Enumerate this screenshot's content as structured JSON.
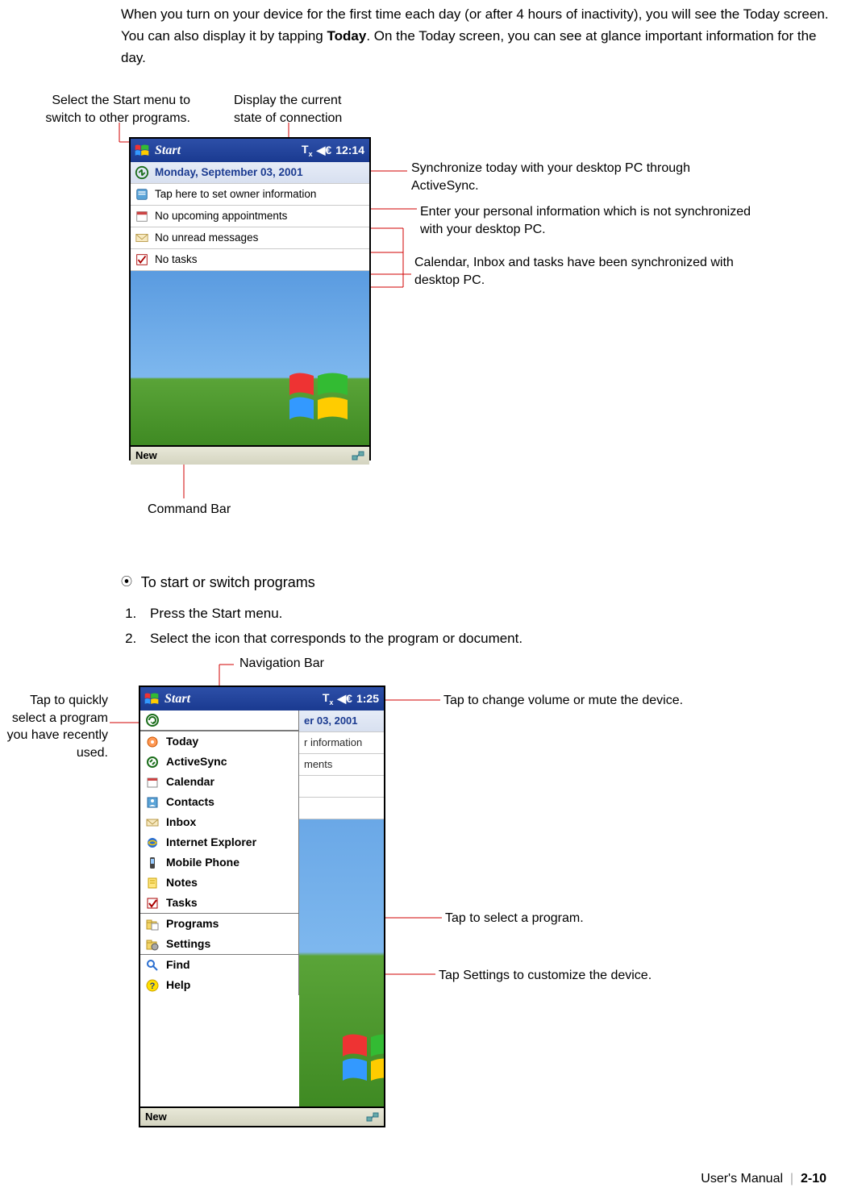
{
  "intro": {
    "text_pre": "When you turn on your device for the first time each day (or after 4 hours of inactivity), you will see the Today screen. You can also display it by tapping ",
    "today_bold": "Today",
    "text_post": ". On the Today screen, you can see at glance important information for the day."
  },
  "annotations1": {
    "start_menu": "Select the Start menu to switch to other programs.",
    "connection": "Display the current state of connection",
    "sync_today": "Synchronize today with your desktop PC through ActiveSync.",
    "owner_info": "Enter your personal information which is not synchronized with your desktop PC.",
    "cal_inbox_tasks": "Calendar, Inbox and tasks have been synchronized with desktop PC.",
    "command_bar": "Command Bar"
  },
  "device1": {
    "start_label": "Start",
    "time": "12:14",
    "date": "Monday, September 03, 2001",
    "owner": "Tap here to set owner information",
    "appointments": "No upcoming appointments",
    "messages": "No unread messages",
    "tasks": "No tasks",
    "cmd_new": "New"
  },
  "section_start": {
    "heading": "To start or switch programs",
    "step1": "Press the Start menu.",
    "step2": "Select the icon that corresponds to the program or document."
  },
  "annotations2": {
    "nav_bar": "Navigation Bar",
    "recent": "Tap to quickly select a program you have recently used.",
    "volume": "Tap to change volume or mute the device.",
    "select_program": "Tap to select a program.",
    "settings": "Tap Settings to customize the device."
  },
  "device2": {
    "start_label": "Start",
    "time": "1:25",
    "menu": {
      "today": "Today",
      "activesync": "ActiveSync",
      "calendar": "Calendar",
      "contacts": "Contacts",
      "inbox": "Inbox",
      "ie": "Internet Explorer",
      "mobile_phone": "Mobile Phone",
      "notes": "Notes",
      "tasks": "Tasks",
      "programs": "Programs",
      "settings": "Settings",
      "find": "Find",
      "help": "Help"
    },
    "bg_date": "er 03, 2001",
    "bg_owner": "r information",
    "bg_appt": "ments",
    "cmd_new": "New"
  },
  "footer": {
    "label": "User's Manual",
    "page": "2-10"
  }
}
